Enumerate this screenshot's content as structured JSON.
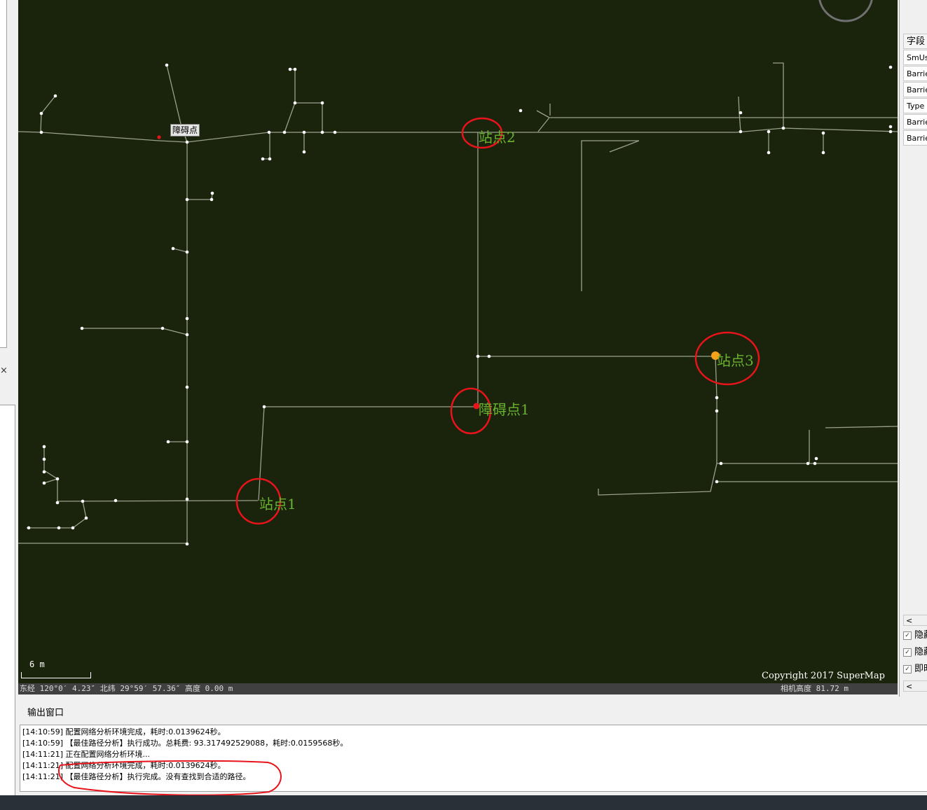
{
  "map": {
    "labels": {
      "station1": "站点1",
      "station2": "站点2",
      "station3": "站点3",
      "barrier1": "障碍点1"
    },
    "tooltip": "障碍点",
    "copyright": "Copyright 2017 SuperMap",
    "scale_label": "6 m",
    "coordinates": "东经 120°0′ 4.23″   北纬 29°59′ 57.36″  高度 0.00 m",
    "camera_height": "相机高度 81.72 m",
    "colors": {
      "background": "#1a230b",
      "road": "#9aa08e",
      "label": "#69b32f",
      "highlight": "#e8141b",
      "station3_marker": "#f7a11a"
    }
  },
  "right_panel": {
    "header": "字段",
    "rows": [
      "SmUse",
      "Barrie",
      "Barrie",
      "Type",
      "Barrie",
      "Barrie"
    ],
    "checkboxes": [
      "隐藏",
      "隐藏",
      "即时"
    ]
  },
  "left_panel": {
    "close_icon": "×"
  },
  "output": {
    "title": "输出窗口",
    "lines": [
      "[14:10:59] 配置网络分析环境完成，耗时:0.0139624秒。",
      "[14:10:59] 【最佳路径分析】执行成功。总耗费: 93.317492529088，耗时:0.0159568秒。",
      "[14:11:21] 正在配置网络分析环境...",
      "[14:11:21] 配置网络分析环境完成，耗时:0.0139624秒。",
      "[14:11:21] 【最佳路径分析】执行完成。没有查找到合适的路径。"
    ]
  }
}
